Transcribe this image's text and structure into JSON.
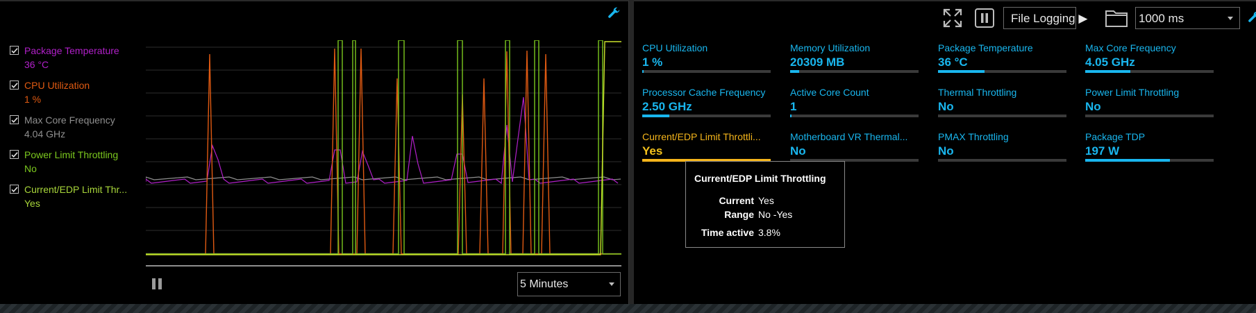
{
  "colors": {
    "package_temperature": "#b020c8",
    "cpu_utilization": "#e05a12",
    "max_core_frequency": "#8f8f8f",
    "power_limit_throttling": "#7cc91e",
    "current_edp_limit_throttling": "#cde22c",
    "metric_accent": "#19b6ee",
    "metric_warning": "#f5b51b"
  },
  "legend": [
    {
      "name": "Package Temperature",
      "value": "36 °C",
      "color": "#b020c8",
      "checked": true
    },
    {
      "name": "CPU Utilization",
      "value": "1 %",
      "color": "#e05a12",
      "checked": true
    },
    {
      "name": "Max Core Frequency",
      "value": "4.04 GHz",
      "color": "#8f8f8f",
      "checked": true
    },
    {
      "name": "Power Limit Throttling",
      "value": "No",
      "color": "#7cc91e",
      "checked": true
    },
    {
      "name": "Current/EDP Limit Thr...",
      "value": "Yes",
      "color": "#a8d63a",
      "checked": true
    }
  ],
  "graph": {
    "time_window": "5 Minutes",
    "paused": false
  },
  "toolbar": {
    "file_logging_label": "File Logging ▶",
    "interval_value": "1000 ms"
  },
  "metrics": [
    {
      "label": "CPU Utilization",
      "value": "1 %",
      "bar_fraction": 0.01,
      "warning": false
    },
    {
      "label": "Memory Utilization",
      "value": "20309  MB",
      "bar_fraction": 0.07,
      "warning": false
    },
    {
      "label": "Package Temperature",
      "value": "36 °C",
      "bar_fraction": 0.36,
      "warning": false
    },
    {
      "label": "Max Core Frequency",
      "value": "4.05 GHz",
      "bar_fraction": 0.35,
      "warning": false
    },
    {
      "label": "Processor Cache Frequency",
      "value": "2.50 GHz",
      "bar_fraction": 0.21,
      "warning": false
    },
    {
      "label": "Active Core Count",
      "value": "1",
      "bar_fraction": 0.01,
      "warning": false
    },
    {
      "label": "Thermal Throttling",
      "value": "No",
      "bar_fraction": 0,
      "warning": false
    },
    {
      "label": "Power Limit Throttling",
      "value": "No",
      "bar_fraction": 0,
      "warning": false
    },
    {
      "label": "Current/EDP Limit Throttli...",
      "value": "Yes",
      "bar_fraction": 1,
      "warning": true
    },
    {
      "label": "Motherboard VR Thermal...",
      "value": "No",
      "bar_fraction": 0,
      "warning": false
    },
    {
      "label": "PMAX Throttling",
      "value": "No",
      "bar_fraction": 0,
      "warning": false
    },
    {
      "label": "Package TDP",
      "value": "197 W",
      "bar_fraction": 0.66,
      "warning": false
    }
  ],
  "tooltip": {
    "title": "Current/EDP Limit Throttling",
    "current_label": "Current",
    "current_value": "Yes",
    "range_label": "Range",
    "range_value": "No -Yes",
    "time_active_label": "Time active",
    "time_active_value": "3.8%"
  }
}
